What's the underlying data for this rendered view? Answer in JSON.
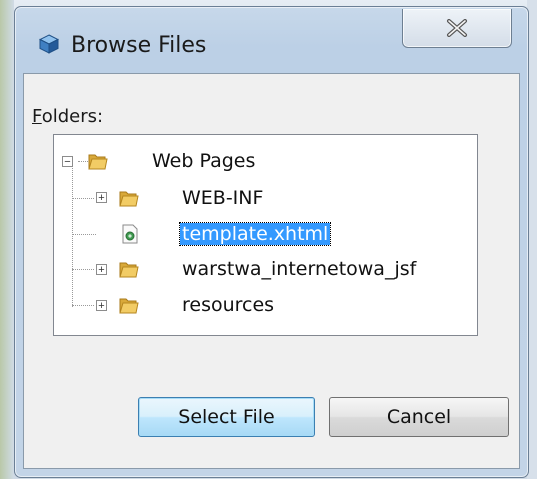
{
  "dialog": {
    "title": "Browse Files",
    "folders_label_mnemonic": "F",
    "folders_label_rest": "olders:",
    "close_icon": "close-x-icon"
  },
  "tree": {
    "items": [
      {
        "label": "Web Pages",
        "icon": "folder-icon",
        "expanded": true
      },
      {
        "label": "WEB-INF",
        "icon": "folder-icon",
        "expanded": false
      },
      {
        "label": "template.xhtml",
        "icon": "file-icon",
        "selected": true
      },
      {
        "label": "warstwa_internetowa_jsf",
        "icon": "folder-icon",
        "expanded": false
      },
      {
        "label": "resources",
        "icon": "folder-icon",
        "expanded": false
      }
    ]
  },
  "buttons": {
    "select": "Select File",
    "cancel": "Cancel"
  },
  "colors": {
    "selection": "#3399ff",
    "folder": "#e8b84a"
  }
}
